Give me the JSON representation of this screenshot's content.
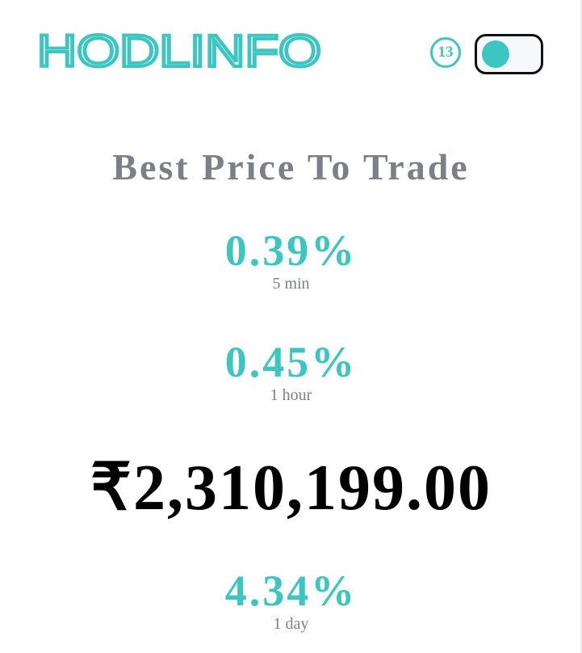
{
  "header": {
    "logo_text": "HODLINFO",
    "timer_value": "13",
    "theme_toggle": {
      "state": "on"
    }
  },
  "main": {
    "title": "Best Price To Trade",
    "stats_top": [
      {
        "value": "0.39%",
        "label": "5 min"
      },
      {
        "value": "0.45%",
        "label": "1 hour"
      }
    ],
    "price": "₹2,310,199.00",
    "stats_bottom": [
      {
        "value": "4.34%",
        "label": "1 day"
      }
    ]
  },
  "colors": {
    "accent": "#3dc6c1",
    "muted_text": "#7d7f87",
    "price_text": "#000000",
    "background": "#ffffff"
  },
  "icons": {
    "timer": "countdown-circle-icon",
    "toggle": "toggle-switch-icon"
  }
}
